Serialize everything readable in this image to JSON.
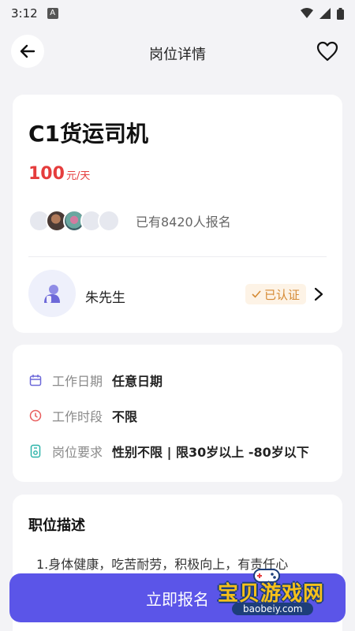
{
  "status_bar": {
    "time": "3:12",
    "notification_icon_letter": "A"
  },
  "header": {
    "title": "岗位详情"
  },
  "job": {
    "title": "C1货运司机",
    "salary_amount": "100",
    "salary_unit": "元/天",
    "signup_text": "已有8420人报名"
  },
  "owner": {
    "name": "朱先生",
    "verified_label": "已认证"
  },
  "info": {
    "rows": [
      {
        "label": "工作日期",
        "value": "任意日期",
        "icon": "calendar-icon"
      },
      {
        "label": "工作时段",
        "value": "不限",
        "icon": "clock-icon"
      },
      {
        "label": "岗位要求",
        "value": "性别不限 | 限30岁以上 -80岁以下",
        "icon": "requirement-icon"
      }
    ]
  },
  "description": {
    "title": "职位描述",
    "text_partial": "1.身体健康，吃苦耐劳，积极向上，有责任心"
  },
  "actions": {
    "apply_label": "立即报名"
  },
  "watermark": {
    "main_text": "宝贝游戏网",
    "url": "baobeiy.com"
  },
  "colors": {
    "accent": "#5b55e8",
    "salary": "#e53d3d",
    "verified": "#d58a34"
  }
}
